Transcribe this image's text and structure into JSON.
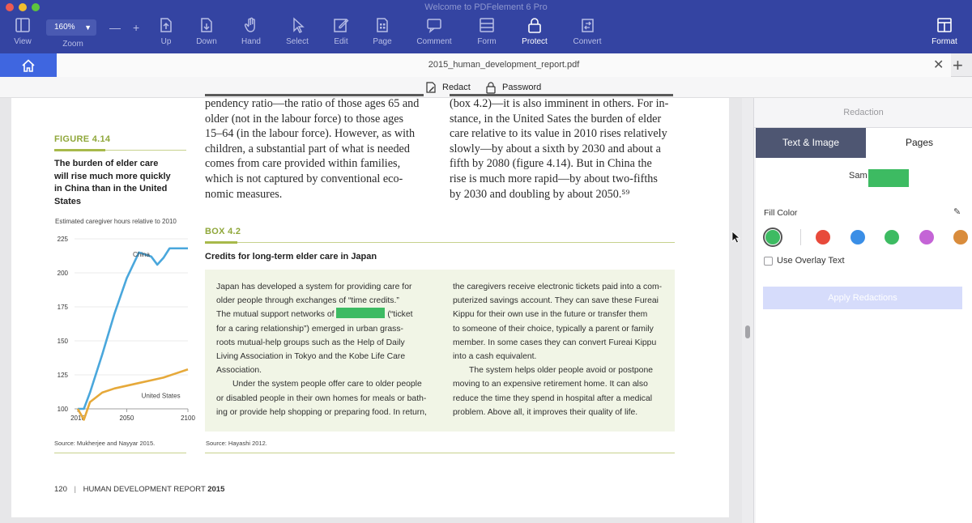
{
  "window": {
    "title": "Welcome to PDFelement 6 Pro"
  },
  "toolbar": {
    "view": "View",
    "zoom": "Zoom",
    "zoom_value": "160%",
    "up": "Up",
    "down": "Down",
    "hand": "Hand",
    "select": "Select",
    "edit": "Edit",
    "page": "Page",
    "comment": "Comment",
    "form": "Form",
    "protect": "Protect",
    "convert": "Convert",
    "format": "Format"
  },
  "tabs": {
    "document": "2015_human_development_report.pdf"
  },
  "subbar": {
    "redact": "Redact",
    "password": "Password"
  },
  "figure": {
    "label": "FIGURE 4.14",
    "title_lines": [
      "The burden of elder care",
      "will rise much more quickly",
      "in China than in the United",
      "States"
    ],
    "caption": "Estimated caregiver hours relative to 2010",
    "source": "Source: Mukherjee and Nayyar 2015."
  },
  "chart_data": {
    "type": "line",
    "title": "Estimated caregiver hours relative to 2010",
    "xlabel": "",
    "ylabel": "",
    "ylim": [
      100,
      225
    ],
    "xlim": [
      2010,
      2100
    ],
    "yticks": [
      100,
      125,
      150,
      175,
      200,
      225
    ],
    "xticks": [
      2010,
      2050,
      2100
    ],
    "series": [
      {
        "name": "China",
        "color": "#4aa7dc",
        "x": [
          2010,
          2015,
          2020,
          2030,
          2040,
          2050,
          2060,
          2070,
          2075,
          2080,
          2085,
          2090,
          2100
        ],
        "y": [
          100,
          100,
          112,
          140,
          170,
          196,
          215,
          212,
          206,
          211,
          218,
          218,
          218
        ]
      },
      {
        "name": "United States",
        "color": "#e6a93a",
        "x": [
          2010,
          2015,
          2020,
          2030,
          2040,
          2050,
          2060,
          2070,
          2080,
          2090,
          2100
        ],
        "y": [
          100,
          92,
          105,
          112,
          115,
          117,
          119,
          121,
          123,
          126,
          129
        ]
      }
    ]
  },
  "main_text": {
    "col1": [
      "pendency ratio—the ratio of those ages 65 and",
      "older (not in the labour force) to those ages",
      "15–64 (in the labour force). However, as with",
      "children, a substantial part of what is needed",
      "comes from care provided within families,",
      "which is not captured by conventional eco-",
      "nomic measures."
    ],
    "col2": [
      "(box 4.2)—it is also imminent in others. For in-",
      "stance, in the United Sates the burden of elder",
      "care relative to its value in 2010 rises relatively",
      "slowly—by about a sixth by 2030 and about a",
      "fifth by 2080 (figure 4.14). But in China the",
      "rise is much more rapid—by about two-fifths",
      "by 2030 and doubling by about 2050.⁵⁹"
    ]
  },
  "box": {
    "label": "BOX 4.2",
    "title": "Credits for long-term elder care in Japan",
    "left": [
      "Japan has developed a system for providing care for",
      "older people through exchanges of “time credits.”",
      "The mutual support networks of",
      "for a caring relationship”) emerged in urban grass-",
      "roots mutual-help groups such as the Help of Daily",
      "Living Association in Tokyo and the Kobe Life Care",
      "Association.",
      "Under the system people offer care to older people",
      "or disabled people in their own homes for meals or bath-",
      "ing or provide help shopping or preparing food. In return,"
    ],
    "left_after_redaction": "(“ticket",
    "right": [
      "the caregivers receive electronic tickets paid into a com-",
      "puterized savings account. They can save these Fureai",
      "Kippu for their own use in the future or transfer them",
      "to someone of their choice, typically a parent or family",
      "member. In some cases they can convert Fureai Kippu",
      "into a cash equivalent.",
      "The system helps older people avoid or postpone",
      "moving to an expensive retirement home. It can also",
      "reduce the time they spend in hospital after a medical",
      "problem. Above all, it improves their quality of life."
    ],
    "source": "Source: Hayashi 2012."
  },
  "footer": {
    "page_no": "120",
    "report": "HUMAN DEVELOPMENT REPORT",
    "year": "2015"
  },
  "panel": {
    "title": "Redaction",
    "tab_text_image": "Text & Image",
    "tab_pages": "Pages",
    "sample": "Sam",
    "fill_color": "Fill Color",
    "overlay": "Use Overlay Text",
    "apply": "Apply Redactions",
    "swatches": [
      "#3dbb62",
      "#e84a3b",
      "#3a8ee6",
      "#3dbb62",
      "#c464d6",
      "#d98c3c"
    ]
  }
}
